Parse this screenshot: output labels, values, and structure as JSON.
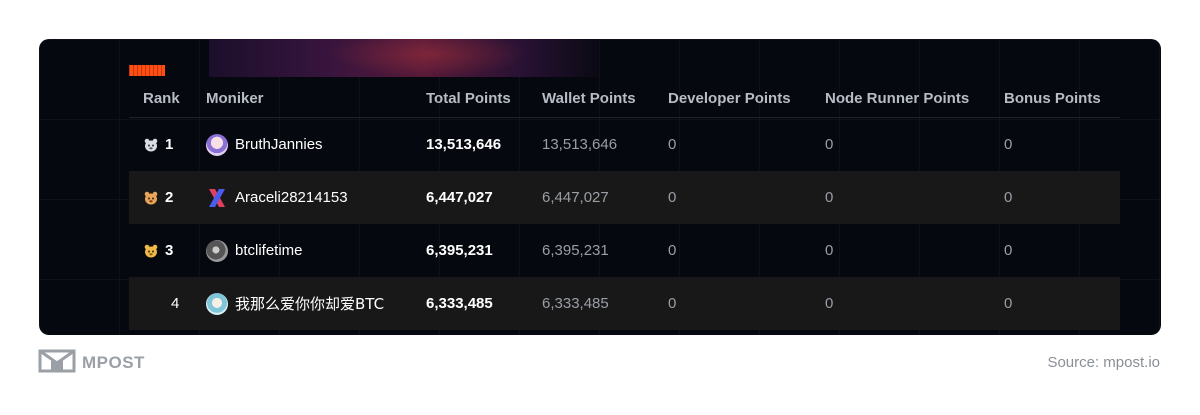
{
  "columns": {
    "rank": "Rank",
    "moniker": "Moniker",
    "total": "Total Points",
    "wallet": "Wallet Points",
    "developer": "Developer Points",
    "node": "Node Runner Points",
    "bonus": "Bonus Points"
  },
  "rows": [
    {
      "rank": "1",
      "moniker": "BruthJannies",
      "total": "13,513,646",
      "wallet": "13,513,646",
      "developer": "0",
      "node": "0",
      "bonus": "0"
    },
    {
      "rank": "2",
      "moniker": "Araceli28214153",
      "total": "6,447,027",
      "wallet": "6,447,027",
      "developer": "0",
      "node": "0",
      "bonus": "0"
    },
    {
      "rank": "3",
      "moniker": "btclifetime",
      "total": "6,395,231",
      "wallet": "6,395,231",
      "developer": "0",
      "node": "0",
      "bonus": "0"
    },
    {
      "rank": "4",
      "moniker": "我那么爱你你却爱BTC",
      "total": "6,333,485",
      "wallet": "6,333,485",
      "developer": "0",
      "node": "0",
      "bonus": "0"
    }
  ],
  "footer": {
    "brand": "MPOST",
    "source": "Source: mpost.io"
  },
  "colors": {
    "card_background": "#05080f",
    "accent_orange": "#ff4d14",
    "alt_row": "#181818"
  },
  "icons": [
    "medal-icon",
    "x-logo-icon",
    "mpost-logo-icon"
  ]
}
